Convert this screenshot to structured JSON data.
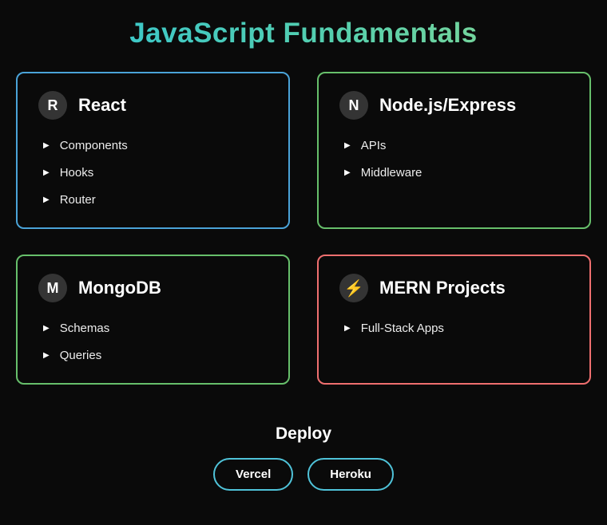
{
  "page": {
    "title": "JavaScript Fundamentals"
  },
  "ui": {
    "bullet": "▶"
  },
  "colors": {
    "background": "#0a0a0a",
    "title_gradient_start": "#2fc3d6",
    "title_gradient_end": "#8ed98e",
    "badge_background": "#343434",
    "bolt": "#ff9f2e",
    "deploy_button_border": "#4fc3d9"
  },
  "cards": [
    {
      "icon": "R",
      "title": "React",
      "color": "#4aa3d8",
      "items": [
        "Components",
        "Hooks",
        "Router"
      ]
    },
    {
      "icon": "N",
      "title": "Node.js/Express",
      "color": "#67bf6b",
      "items": [
        "APIs",
        "Middleware"
      ]
    },
    {
      "icon": "M",
      "title": "MongoDB",
      "color": "#67bf6b",
      "items": [
        "Schemas",
        "Queries"
      ]
    },
    {
      "icon": "⚡",
      "title": "MERN Projects",
      "color": "#ef6f6f",
      "items": [
        "Full-Stack Apps"
      ]
    }
  ],
  "deploy": {
    "heading": "Deploy",
    "buttons": [
      "Vercel",
      "Heroku"
    ]
  }
}
